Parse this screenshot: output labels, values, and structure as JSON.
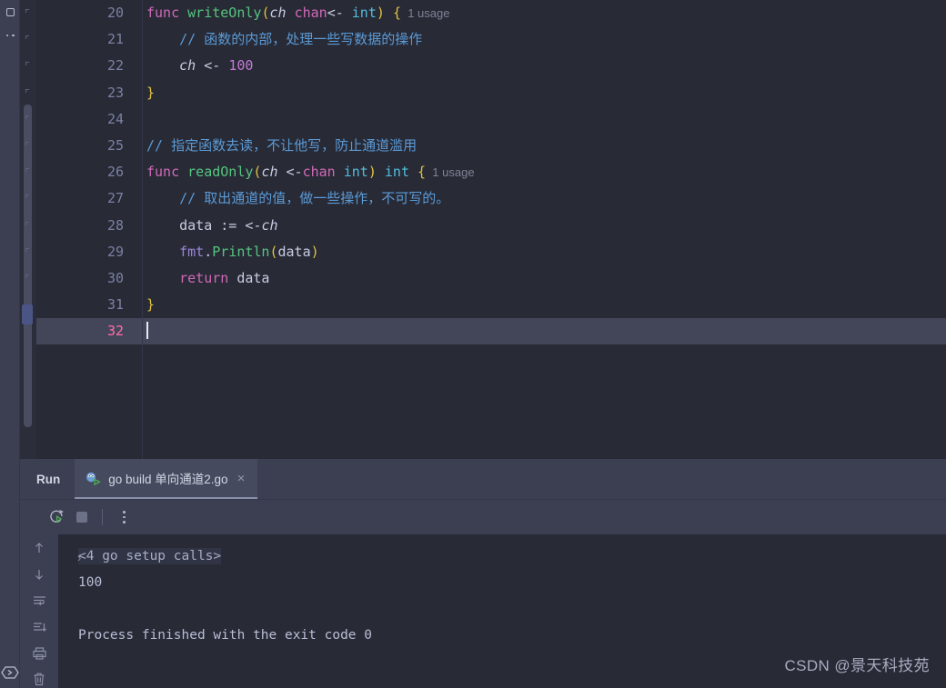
{
  "rail": {
    "top_items": [
      {
        "name": "project-structure-icon",
        "glyph": "square"
      },
      {
        "name": "more-options-icon",
        "glyph": "dots"
      }
    ],
    "bottom_items": [
      {
        "name": "terminal-icon",
        "glyph": "hex-chevron"
      }
    ]
  },
  "editor": {
    "first_line": 20,
    "active_line": 32,
    "lines": [
      {
        "num": "20",
        "tokens": [
          {
            "t": "func ",
            "c": "kw"
          },
          {
            "t": "writeOnly",
            "c": "fn"
          },
          {
            "t": "(",
            "c": "brk"
          },
          {
            "t": "ch",
            "c": "par"
          },
          {
            "t": " ",
            "c": "txt"
          },
          {
            "t": "chan",
            "c": "kw"
          },
          {
            "t": "<- ",
            "c": "txt"
          },
          {
            "t": "int",
            "c": "typ"
          },
          {
            "t": ")",
            "c": "brk"
          },
          {
            "t": " ",
            "c": "txt"
          },
          {
            "t": "{",
            "c": "brk"
          },
          {
            "t": "  1 usage",
            "c": "hint"
          }
        ]
      },
      {
        "num": "21",
        "tokens": [
          {
            "t": "    // 函数的内部，处理一些写数据的操作",
            "c": "cmt"
          }
        ]
      },
      {
        "num": "22",
        "tokens": [
          {
            "t": "    ",
            "c": "txt"
          },
          {
            "t": "ch",
            "c": "par"
          },
          {
            "t": " <- ",
            "c": "txt"
          },
          {
            "t": "100",
            "c": "num"
          }
        ]
      },
      {
        "num": "23",
        "tokens": [
          {
            "t": "}",
            "c": "brk"
          }
        ]
      },
      {
        "num": "24",
        "tokens": []
      },
      {
        "num": "25",
        "tokens": [
          {
            "t": "// 指定函数去读，不让他写，防止通道滥用",
            "c": "cmt"
          }
        ]
      },
      {
        "num": "26",
        "tokens": [
          {
            "t": "func ",
            "c": "kw"
          },
          {
            "t": "readOnly",
            "c": "fn"
          },
          {
            "t": "(",
            "c": "brk"
          },
          {
            "t": "ch",
            "c": "par"
          },
          {
            "t": " <-",
            "c": "txt"
          },
          {
            "t": "chan",
            "c": "kw"
          },
          {
            "t": " ",
            "c": "txt"
          },
          {
            "t": "int",
            "c": "typ"
          },
          {
            "t": ")",
            "c": "brk"
          },
          {
            "t": " ",
            "c": "txt"
          },
          {
            "t": "int",
            "c": "typ"
          },
          {
            "t": " ",
            "c": "txt"
          },
          {
            "t": "{",
            "c": "brk"
          },
          {
            "t": "  1 usage",
            "c": "hint"
          }
        ]
      },
      {
        "num": "27",
        "tokens": [
          {
            "t": "    // 取出通道的值，做一些操作，不可写的。",
            "c": "cmt"
          }
        ]
      },
      {
        "num": "28",
        "tokens": [
          {
            "t": "    data := <-",
            "c": "txt"
          },
          {
            "t": "ch",
            "c": "par"
          }
        ]
      },
      {
        "num": "29",
        "tokens": [
          {
            "t": "    ",
            "c": "txt"
          },
          {
            "t": "fmt",
            "c": "pkg"
          },
          {
            "t": ".",
            "c": "txt"
          },
          {
            "t": "Println",
            "c": "fn"
          },
          {
            "t": "(",
            "c": "brk"
          },
          {
            "t": "data",
            "c": "txt"
          },
          {
            "t": ")",
            "c": "brk"
          }
        ]
      },
      {
        "num": "30",
        "tokens": [
          {
            "t": "    ",
            "c": "txt"
          },
          {
            "t": "return",
            "c": "kw"
          },
          {
            "t": " data",
            "c": "txt"
          }
        ]
      },
      {
        "num": "31",
        "tokens": [
          {
            "t": "}",
            "c": "brk"
          }
        ]
      },
      {
        "num": "32",
        "tokens": [],
        "active": true,
        "caret": true
      }
    ]
  },
  "run_panel": {
    "title": "Run",
    "tab": {
      "icon": "go-run-icon",
      "label": "go build 单向通道2.go",
      "close": "×"
    },
    "toolbar": [
      {
        "name": "rerun-button",
        "icon": "rerun-icon"
      },
      {
        "name": "stop-button",
        "icon": "stop-icon"
      },
      {
        "name": "more-actions-button",
        "icon": "vertical-dots-icon"
      }
    ],
    "console_rail": [
      {
        "name": "prev-occurrence-button",
        "icon": "arrow-up-icon"
      },
      {
        "name": "next-occurrence-button",
        "icon": "arrow-down-icon"
      },
      {
        "name": "soft-wrap-button",
        "icon": "soft-wrap-icon"
      },
      {
        "name": "scroll-to-end-button",
        "icon": "scroll-to-end-icon"
      },
      {
        "name": "print-button",
        "icon": "print-icon"
      },
      {
        "name": "clear-all-button",
        "icon": "trash-icon"
      }
    ],
    "console": {
      "fold_chevron": "›",
      "folded_text": "<4 go setup calls>",
      "line_output": "100",
      "line_exit": "Process finished with the exit code 0"
    }
  },
  "watermark": "CSDN @景天科技苑",
  "colors": {
    "editor_bg": "#282a36",
    "panel_bg": "#3c3f51",
    "active_row": "#434659",
    "keyword": "#d06ab8",
    "function": "#55c57f",
    "type": "#53bedd",
    "comment": "#5b9ad5",
    "number": "#c47ad6",
    "bracket": "#e0c341",
    "line_number": "#7b82a3",
    "active_line_number": "#ff6ea9"
  }
}
